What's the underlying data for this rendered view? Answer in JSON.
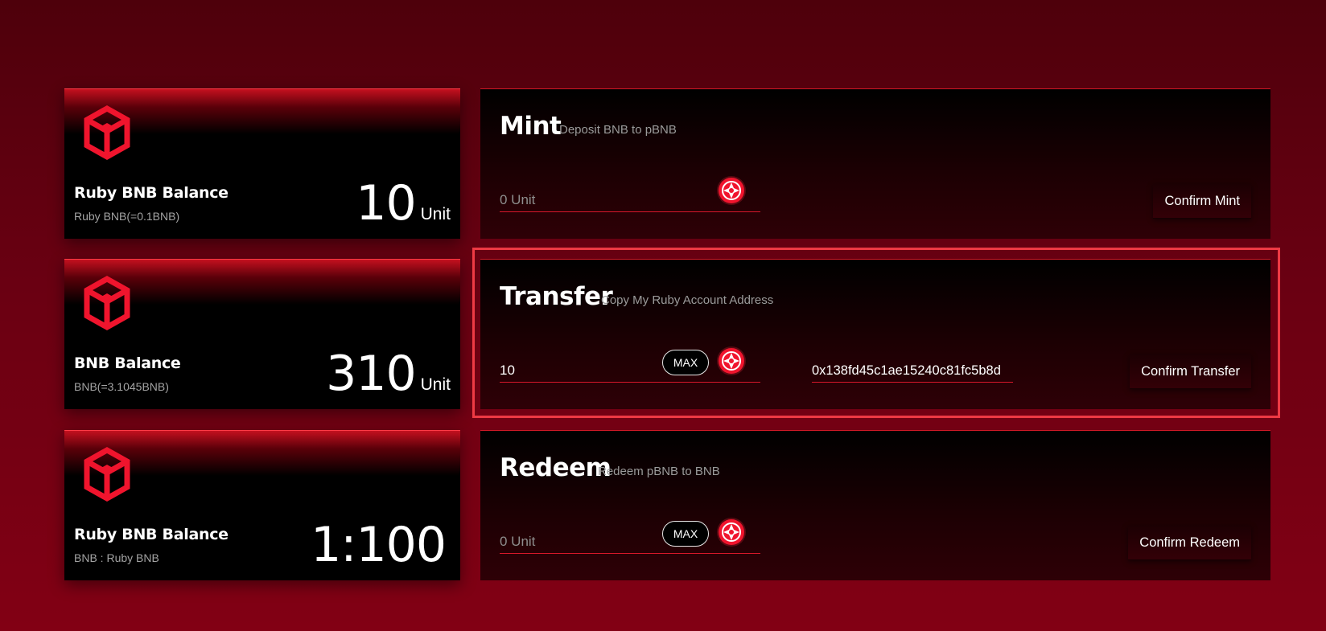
{
  "balances": [
    {
      "title": "Ruby BNB Balance",
      "subtitle": "Ruby BNB(=0.1BNB)",
      "value": "10",
      "unit": "Unit"
    },
    {
      "title": "BNB Balance",
      "subtitle": "BNB(=3.1045BNB)",
      "value": "310",
      "unit": "Unit"
    },
    {
      "title": "Ruby BNB Balance",
      "subtitle": "BNB : Ruby BNB",
      "value": "1:100",
      "unit": ""
    }
  ],
  "mint": {
    "title": "Mint",
    "subtitle": "Deposit BNB to pBNB",
    "amount_placeholder": "0 Unit",
    "confirm_label": "Confirm Mint"
  },
  "transfer": {
    "title": "Transfer",
    "subtitle": "Copy My Ruby Account Address",
    "amount_value": "10",
    "max_label": "MAX",
    "address_value": "0x138fd45c1ae15240c81fc5b8d",
    "confirm_label": "Confirm Transfer"
  },
  "redeem": {
    "title": "Redeem",
    "subtitle": "Redeem pBNB to BNB",
    "amount_placeholder": "0 Unit",
    "max_label": "MAX",
    "confirm_label": "Confirm Redeem"
  },
  "colors": {
    "accent": "#f0142d",
    "highlight": "#ee3a44"
  },
  "icons": {
    "balance_logo": "bnb-cube-icon",
    "token": "ruby-token-icon"
  }
}
